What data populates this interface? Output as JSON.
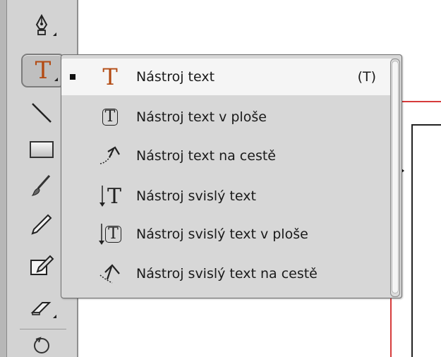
{
  "toolbar": {
    "tools": [
      {
        "name": "pen-tool-icon"
      },
      {
        "name": "type-tool-icon",
        "glyph": "T",
        "active": true
      },
      {
        "name": "line-tool-icon"
      },
      {
        "name": "rectangle-tool-icon"
      },
      {
        "name": "brush-tool-icon"
      },
      {
        "name": "pencil-tool-icon"
      },
      {
        "name": "edit-tool-icon"
      },
      {
        "name": "eraser-tool-icon"
      },
      {
        "name": "rotate-tool-icon"
      }
    ]
  },
  "menu": {
    "items": [
      {
        "label": "Nástroj text",
        "shortcut": "(T)",
        "selected": true,
        "icon": "type-tool-icon",
        "glyph": "T"
      },
      {
        "label": "Nástroj text v ploše",
        "icon": "area-type-tool-icon",
        "glyph": "T"
      },
      {
        "label": "Nástroj text na cestě",
        "icon": "type-on-path-tool-icon"
      },
      {
        "label": "Nástroj svislý text",
        "icon": "vertical-type-tool-icon",
        "glyph": "T"
      },
      {
        "label": "Nástroj svislý text v ploše",
        "icon": "vertical-area-type-tool-icon",
        "glyph": "T"
      },
      {
        "label": "Nástroj svislý text na cestě",
        "icon": "vertical-type-on-path-tool-icon"
      }
    ]
  },
  "colors": {
    "accent_type_icon": "#b34a12",
    "guide_red": "#d63b3b",
    "menu_bg": "#d7d7d7",
    "toolbar_bg": "#d3d3d3"
  }
}
